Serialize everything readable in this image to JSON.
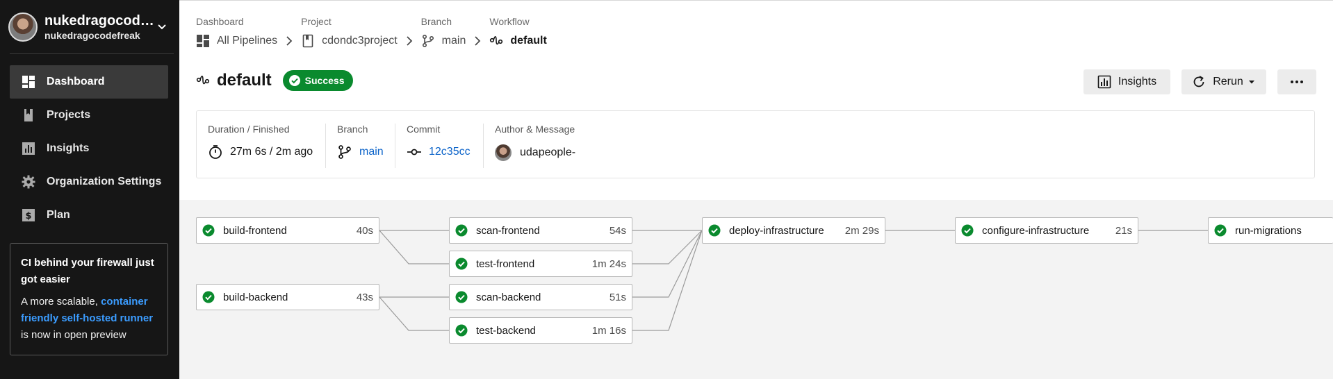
{
  "user": {
    "name": "nukedragocodefreak",
    "handle": "nukedragocodefreak"
  },
  "nav": [
    {
      "label": "Dashboard",
      "icon": "dashboard-icon"
    },
    {
      "label": "Projects",
      "icon": "projects-icon"
    },
    {
      "label": "Insights",
      "icon": "insights-icon"
    },
    {
      "label": "Organization Settings",
      "icon": "gear-icon"
    },
    {
      "label": "Plan",
      "icon": "plan-icon"
    }
  ],
  "promo": {
    "title": "CI behind your firewall just got easier",
    "text_before": "A more scalable,",
    "link": "container friendly self-hosted runner",
    "text_after": "is now in open preview"
  },
  "breadcrumbs": [
    {
      "label": "Dashboard",
      "value": "All Pipelines"
    },
    {
      "label": "Project",
      "value": "cdondc3project"
    },
    {
      "label": "Branch",
      "value": "main"
    },
    {
      "label": "Workflow",
      "value": "default"
    }
  ],
  "workflow": {
    "title": "default",
    "status": "Success"
  },
  "actions": {
    "insights": "Insights",
    "rerun": "Rerun"
  },
  "info": {
    "duration_label": "Duration / Finished",
    "duration_value": "27m 6s / 2m ago",
    "branch_label": "Branch",
    "branch_value": "main",
    "commit_label": "Commit",
    "commit_value": "12c35cc",
    "author_label": "Author & Message",
    "author_value": "udapeople-"
  },
  "jobs": [
    {
      "name": "build-frontend",
      "duration": "40s"
    },
    {
      "name": "build-backend",
      "duration": "43s"
    },
    {
      "name": "scan-frontend",
      "duration": "54s"
    },
    {
      "name": "test-frontend",
      "duration": "1m 24s"
    },
    {
      "name": "scan-backend",
      "duration": "51s"
    },
    {
      "name": "test-backend",
      "duration": "1m 16s"
    },
    {
      "name": "deploy-infrastructure",
      "duration": "2m 29s"
    },
    {
      "name": "configure-infrastructure",
      "duration": "21s"
    },
    {
      "name": "run-migrations",
      "duration": ""
    }
  ],
  "colors": {
    "success": "#0a8a2e",
    "link": "#0b63c9",
    "promo_link": "#3b9cff",
    "sidebar": "#161616"
  }
}
